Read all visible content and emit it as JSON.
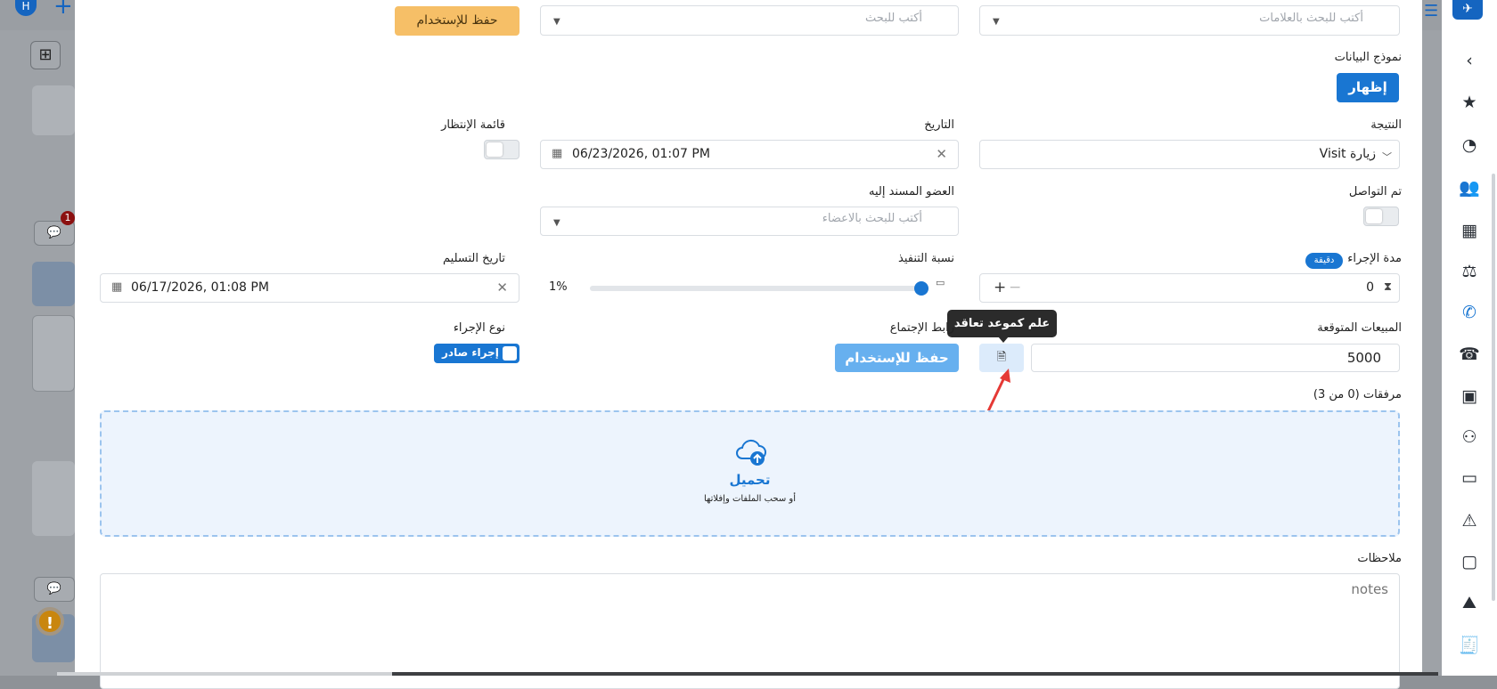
{
  "background": {
    "avatar_letter": "H",
    "badge_count": "1"
  },
  "modal": {
    "top_row": {
      "tags_placeholder": "أكتب للبحث بالعلامات",
      "search_placeholder": "أكتب للبحث",
      "save_use_label": "حفظ للإستخدام"
    },
    "data_model": {
      "label": "نموذج البيانات",
      "show_button": "إظهار"
    },
    "result": {
      "label": "النتيجة",
      "value": "Visit زيارة"
    },
    "date": {
      "label": "التاريخ",
      "value": "06/23/2026, 01:07 PM"
    },
    "waiting_list": {
      "label": "قائمة الإنتظار",
      "on": false
    },
    "contacted": {
      "label": "تم التواصل",
      "on": false
    },
    "assignee": {
      "label": "العضو المسند إليه",
      "placeholder": "أكتب للبحث بالاعضاء"
    },
    "duration": {
      "label": "مدة الإجراء",
      "unit_badge": "دقيقة",
      "value": "0"
    },
    "completion": {
      "label": "نسبة التنفيذ",
      "value_text": "1%",
      "percent": 1
    },
    "delivery_date": {
      "label": "تاريخ التسليم",
      "value": "06/17/2026, 01:08 PM"
    },
    "expected_sales": {
      "label": "المبيعات المتوقعة",
      "value": "5000"
    },
    "meeting_link": {
      "label": "رابط الإجتماع",
      "save_button": "حفظ للإستخدام"
    },
    "tooltip": "علم كموعد تعاقد",
    "action_type": {
      "label": "نوع الإجراء",
      "value": "إجراء صادر"
    },
    "attachments": {
      "label": "مرفقات (0 من 3)",
      "upload_title": "تحميل",
      "upload_sub": "أو سحب الملفات وإفلاتها"
    },
    "notes": {
      "label": "ملاحظات",
      "placeholder": "notes"
    }
  },
  "colors": {
    "primary": "#1976d2",
    "orange_button": "#f6bf67",
    "annotation_arrow": "#e53935"
  }
}
